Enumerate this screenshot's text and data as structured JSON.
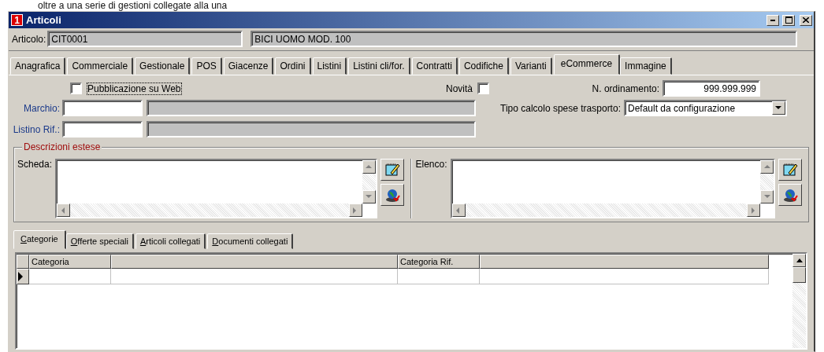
{
  "caption": "oltre a una serie di gestioni collegate alla una",
  "window": {
    "title": "Articoli",
    "app_icon": "1"
  },
  "article": {
    "label": "Articolo:",
    "code": "CIT0001",
    "description": "BICI UOMO MOD. 100"
  },
  "tabs": [
    {
      "label": "Anagrafica",
      "selected": false
    },
    {
      "label": "Commerciale",
      "selected": false
    },
    {
      "label": "Gestionale",
      "selected": false
    },
    {
      "label": "POS",
      "selected": false
    },
    {
      "label": "Giacenze",
      "selected": false
    },
    {
      "label": "Ordini",
      "selected": false
    },
    {
      "label": "Listini",
      "selected": false
    },
    {
      "label": "Listini cli/for.",
      "selected": false
    },
    {
      "label": "Contratti",
      "selected": false
    },
    {
      "label": "Codifiche",
      "selected": false
    },
    {
      "label": "Varianti",
      "selected": false
    },
    {
      "label": "eCommerce",
      "selected": true
    },
    {
      "label": "Immagine",
      "selected": false
    }
  ],
  "form": {
    "web": {
      "label": "Pubblicazione su Web",
      "checked": false
    },
    "novita": {
      "label": "Novità",
      "checked": false
    },
    "ordinamento": {
      "label": "N. ordinamento:",
      "value": "999.999.999"
    },
    "marchio": {
      "label": "Marchio:"
    },
    "listino": {
      "label": "Listino Rif.:"
    },
    "trasporto": {
      "label": "Tipo calcolo spese trasporto:",
      "value": "Default da configurazione"
    }
  },
  "descriptions": {
    "title": "Descrizioni estese",
    "fields": [
      {
        "label": "Scheda:"
      },
      {
        "label": "Elenco:"
      }
    ]
  },
  "subtabs": [
    {
      "label": "Categorie",
      "selected": true
    },
    {
      "label": "Offerte speciali",
      "selected": false
    },
    {
      "label": "Articoli collegati",
      "selected": false
    },
    {
      "label": "Documenti collegati",
      "selected": false
    }
  ],
  "grid": {
    "columns": [
      {
        "kind": "titled",
        "label": "Categoria"
      },
      {
        "kind": "untitled"
      },
      {
        "kind": "titled",
        "label": "Categoria Rif."
      },
      {
        "kind": "untitled"
      }
    ],
    "rows": [
      {
        "current": true
      }
    ]
  }
}
